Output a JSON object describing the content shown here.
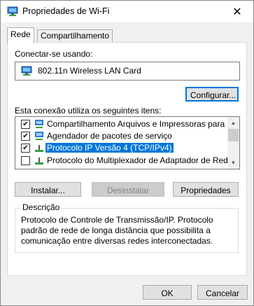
{
  "window": {
    "title": "Propriedades de Wi-Fi",
    "close_glyph": "✕"
  },
  "tabs": [
    {
      "label": "Rede"
    },
    {
      "label": "Compartilhamento"
    }
  ],
  "connect": {
    "label": "Conectar-se usando:",
    "adapter_name": "802.11n Wireless LAN Card",
    "adapter_icon": "network-adapter-icon"
  },
  "configure_button": "Configurar...",
  "items_label": "Esta conexão utiliza os seguintes itens:",
  "items": [
    {
      "label": "Compartilhamento Arquivos e Impressoras para Redes",
      "checked": true,
      "icon": "network-icon"
    },
    {
      "label": "Agendador de pacotes de serviço",
      "checked": true,
      "icon": "network-icon"
    },
    {
      "label": "Protocolo IP Versão 4 (TCP/IPv4)",
      "checked": true,
      "icon": "protocol-icon",
      "selected": true
    },
    {
      "label": "Protocolo do Multiplexador de Adaptador de Rede da M",
      "checked": false,
      "icon": "protocol-icon"
    }
  ],
  "actions": {
    "install": "Instalar...",
    "uninstall": "Desinstalar",
    "properties": "Propriedades"
  },
  "description": {
    "title": "Descrição",
    "text": "Protocolo de Controle de Transmissão/IP. Protocolo padrão de rede de longa distância que possibilita a comunicação entre diversas redes interconectadas."
  },
  "footer": {
    "ok": "OK",
    "cancel": "Cancelar"
  },
  "colors": {
    "selection": "#0078d7",
    "focus_border": "#0078d7",
    "window_bg": "#f0f0f0"
  }
}
